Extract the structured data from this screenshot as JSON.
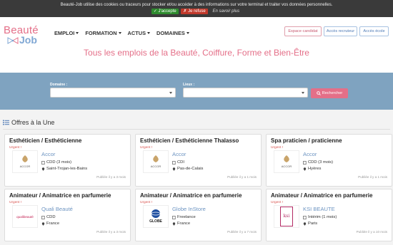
{
  "cookie": {
    "message": "Beauté-Job utilise des cookies ou traceurs pour stocker et/ou accéder à des informations sur votre terminal et traiter vos données personnelles.",
    "accept": "✓ J'accepte",
    "refuse": "✗ Je refuse",
    "more": "En savoir plus"
  },
  "brand": {
    "word1": "Beauté",
    "word2": "Job",
    "pink": "#e46f88",
    "blue": "#7fa7d4"
  },
  "nav": [
    "EMPLOI",
    "FORMATION",
    "ACTUS",
    "DOMAINES"
  ],
  "header_buttons": {
    "candidat": "Espace candidat",
    "recruteur": "Accès recruteur",
    "ecole": "Accès école"
  },
  "hero": {
    "title": "Tous les emplois de la Beauté, Coiffure, Forme et Bien-Être"
  },
  "search": {
    "domaine_label": "Domaine :",
    "lieux_label": "Lieux :",
    "button": "Rechercher"
  },
  "section": {
    "title": "Offres à la Une"
  },
  "cards": [
    {
      "title": "Esthéticien / Esthéticienne",
      "urgent": "Urgent !",
      "company": "Accor",
      "logo": "accor",
      "type": "CDD (3 mois)",
      "location": "Saint-Trojan-les-Bains",
      "published": "Publiée il y a 3 mois"
    },
    {
      "title": "Esthéticien / Esthéticienne Thalasso",
      "urgent": "Urgent !",
      "company": "Accor",
      "logo": "accor",
      "type": "CDI",
      "location": "Pas-de-Calais",
      "published": "Publiée il y a 1 mois"
    },
    {
      "title": "Spa praticien / praticienne",
      "urgent": "Urgent !",
      "company": "Accor",
      "logo": "accor",
      "type": "CDD (3 mois)",
      "location": "Hyères",
      "published": "Publiée il y a 1 mois"
    },
    {
      "title": "Animateur / Animatrice en parfumerie",
      "urgent": "Urgent !",
      "company": "Quali Beauté",
      "logo": "quali",
      "type": "CDD",
      "location": "France",
      "published": "Publiée il y a 3 mois"
    },
    {
      "title": "Animateur / Animatrice en parfumerie",
      "urgent": "Urgent !",
      "company": "Globe InStore",
      "logo": "globe",
      "type": "Freelance",
      "location": "France",
      "published": "Publiée il y a 7 mois"
    },
    {
      "title": "Animateur / Animatrice en parfumerie",
      "urgent": "Urgent !",
      "company": "KSI BEAUTE",
      "logo": "ksi",
      "type": "Intérim (1 mois)",
      "location": "Paris",
      "published": "Publiée il y a 10 mois"
    }
  ],
  "logo_text": {
    "accor": "ACCOR",
    "quali": "qualibeauté",
    "globe": "GLOBE",
    "ksi": "ksi"
  }
}
